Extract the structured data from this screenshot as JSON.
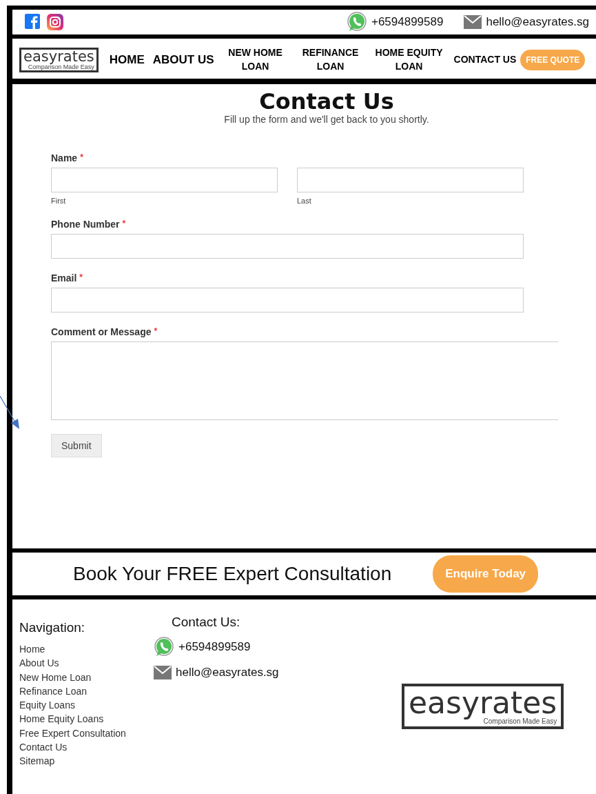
{
  "top_bar": {
    "phone": "+6594899589",
    "email": "hello@easyrates.sg"
  },
  "nav": {
    "logo": {
      "name": "easyrates",
      "tagline": "Comparison Made Easy"
    },
    "items": [
      {
        "label": "HOME"
      },
      {
        "label": "ABOUT US"
      },
      {
        "label": "NEW HOME LOAN"
      },
      {
        "label": "REFINANCE LOAN"
      },
      {
        "label": "HOME EQUITY LOAN"
      },
      {
        "label": "CONTACT US"
      }
    ],
    "cta": "FREE QUOTE"
  },
  "form": {
    "title": "Contact Us",
    "subtitle": "Fill up the form and we'll get back to you shortly.",
    "fields": [
      {
        "kind": "name",
        "label": "Name",
        "required_mark": "*",
        "sublabels": [
          "First",
          "Last"
        ]
      },
      {
        "kind": "text",
        "label": "Phone Number",
        "required_mark": "*"
      },
      {
        "kind": "text",
        "label": "Email",
        "required_mark": "*"
      },
      {
        "kind": "textarea",
        "label": "Comment or Message",
        "required_mark": "*"
      }
    ],
    "submit": "Submit"
  },
  "consult": {
    "heading": "Book Your FREE Expert Consultation",
    "button": "Enquire Today"
  },
  "footer": {
    "nav_title": "Navigation:",
    "nav_links": [
      "Home",
      "About Us",
      "New Home Loan",
      "Refinance Loan",
      "Equity Loans",
      "Home Equity Loans",
      "Free Expert Consultation",
      "Contact Us",
      "Sitemap"
    ],
    "contact_title": "Contact Us:",
    "phone": "+6594899589",
    "email": "hello@easyrates.sg",
    "logo": {
      "name": "easyrates",
      "tagline": "Comparison Made Easy"
    }
  }
}
